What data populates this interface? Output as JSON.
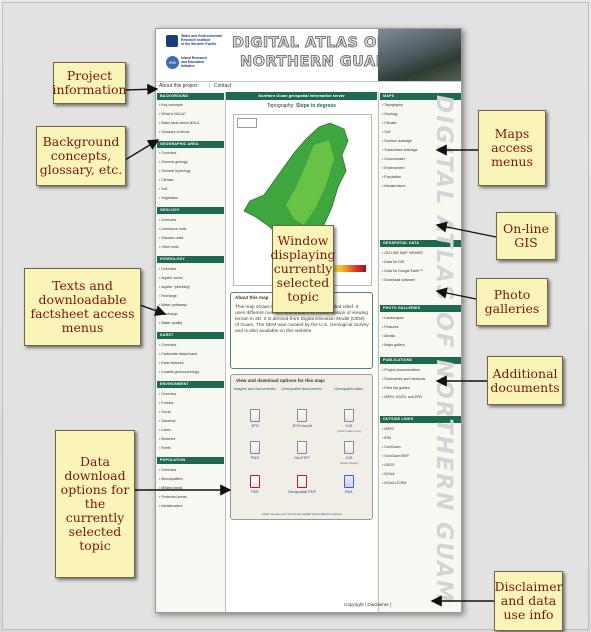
{
  "site": {
    "header_title_line1": "DIGITAL ATLAS OF",
    "header_title_line2": "NORTHERN GUAM",
    "watermark": "DIGITAL ATLAS OF NORTHERN GUAM",
    "org_lines": [
      "Water and Environmental",
      "Research Institute",
      "of the Western Pacific"
    ],
    "org2_lines": [
      "Island Research",
      "and Education",
      "Initiative"
    ],
    "logo2_text": "IREI",
    "top_nav": [
      "About this project",
      "Contact"
    ]
  },
  "left_menu": {
    "sections": [
      {
        "title": "BACKGROUND",
        "items": [
          "Key concepts",
          "What is NGLA?",
          "Basic facts about NGLA",
          "Glossary of terms"
        ]
      },
      {
        "title": "GEOGRAPHIC AREA",
        "items": [
          "Overview",
          "General geology",
          "General hydrology",
          "Climate",
          "Soil",
          "Vegetation"
        ]
      },
      {
        "title": "GEOLOGY",
        "items": [
          "Overview",
          "Limestone units",
          "Volcanic units",
          "Other units"
        ]
      },
      {
        "title": "HYDROLOGY",
        "items": [
          "Overview",
          "Aquifer zones",
          "Aquifer \"plumbing\"",
          "Recharge",
          "Water pathways",
          "Discharge",
          "Water quality"
        ]
      },
      {
        "title": "KARST",
        "items": [
          "Overview",
          "Carbonate island karst",
          "Karst features",
          "Coastal geomorphology"
        ]
      },
      {
        "title": "ENVIRONMENT",
        "items": [
          "Overview",
          "Forests",
          "Scrub",
          "Savanna",
          "Lakes",
          "Beaches",
          "Reefs"
        ]
      },
      {
        "title": "POPULATION",
        "items": [
          "Overview",
          "Municipalities",
          "Military lands",
          "Protected areas",
          "Infrastructure"
        ]
      }
    ]
  },
  "right_menu": {
    "sections": [
      {
        "title": "MAPS",
        "items": [
          "Topography",
          "Geology",
          "Climate",
          "Soil",
          "Surface drainage",
          "Subsurface drainage",
          "Groundwater",
          "Environment",
          "Population",
          "Infrastructure"
        ]
      },
      {
        "title": "GEOSPATIAL DATA",
        "items": [
          "ON-LINE MAP VIEWER",
          "Data for GIS",
          "Data for Google Earth™",
          "Download software"
        ]
      },
      {
        "title": "PHOTO GALLERIES",
        "items": [
          "Landscapes",
          "Features",
          "Aerials",
          "Maps gallery"
        ]
      },
      {
        "title": "PUBLICATIONS",
        "items": [
          "Project documentation",
          "Summaries and handouts",
          "Field trip guides",
          "WERI, USGS, and EPA"
        ]
      },
      {
        "title": "OUTSIDE LINKS",
        "items": [
          "WERI",
          "IREI",
          "GovGuam",
          "GovGuam BSP",
          "USGS",
          "NOAA",
          "NOAA OCRM"
        ]
      }
    ]
  },
  "center": {
    "server_title": "Northern Guam geospatial information server",
    "map_title_prefix": "Topography:",
    "map_title_value": "Slope in degrees",
    "about_title": "About this map",
    "about_text": "This map shows topography in the form of shaded relief. It uses different nuances and shades to create illusion of viewing terrain in 3D. It is derived from Digital Elevation Model (DEM) of Guam. The DEM was created by the U.S. Geological Survey and is also available on this website.",
    "download_title": "View and download options for this map:",
    "download_columns": [
      "Images and documents:",
      "Geospatial documents:",
      "Geospatial data:"
    ],
    "download_items": [
      {
        "label": "JPG",
        "note": ""
      },
      {
        "label": "JPG+world",
        "note": ""
      },
      {
        "label": "GIS",
        "note": "(north Guam only)"
      },
      {
        "label": "PNG",
        "note": ""
      },
      {
        "label": "GeoTIFF",
        "note": ""
      },
      {
        "label": "GIS",
        "note": "(entire Guam)"
      },
      {
        "label": "PDF",
        "note": ""
      },
      {
        "label": "Geospatial PDF",
        "note": ""
      },
      {
        "label": "KML",
        "note": ""
      }
    ],
    "download_note": "Place mouse over icon to see details about different options."
  },
  "footer": {
    "text": "Copyright | Disclaimer |"
  },
  "callouts": {
    "project_information": "Project information",
    "background": "Background concepts, glossary, etc.",
    "texts": "Texts and downloadable factsheet access menus",
    "window": "Window displaying currently selected topic",
    "maps": "Maps access menus",
    "online_gis": "On-line GIS",
    "photo": "Photo galleries",
    "additional": "Additional documents",
    "data_download": "Data download options for the currently selected topic",
    "disclaimer": "Disclaimer and data use info"
  },
  "colors": {
    "section_header": "#1f6a4e",
    "callout_fill": "#fbf4b8",
    "callout_text": "#7a1608",
    "page_bg": "#f5f4ec"
  }
}
